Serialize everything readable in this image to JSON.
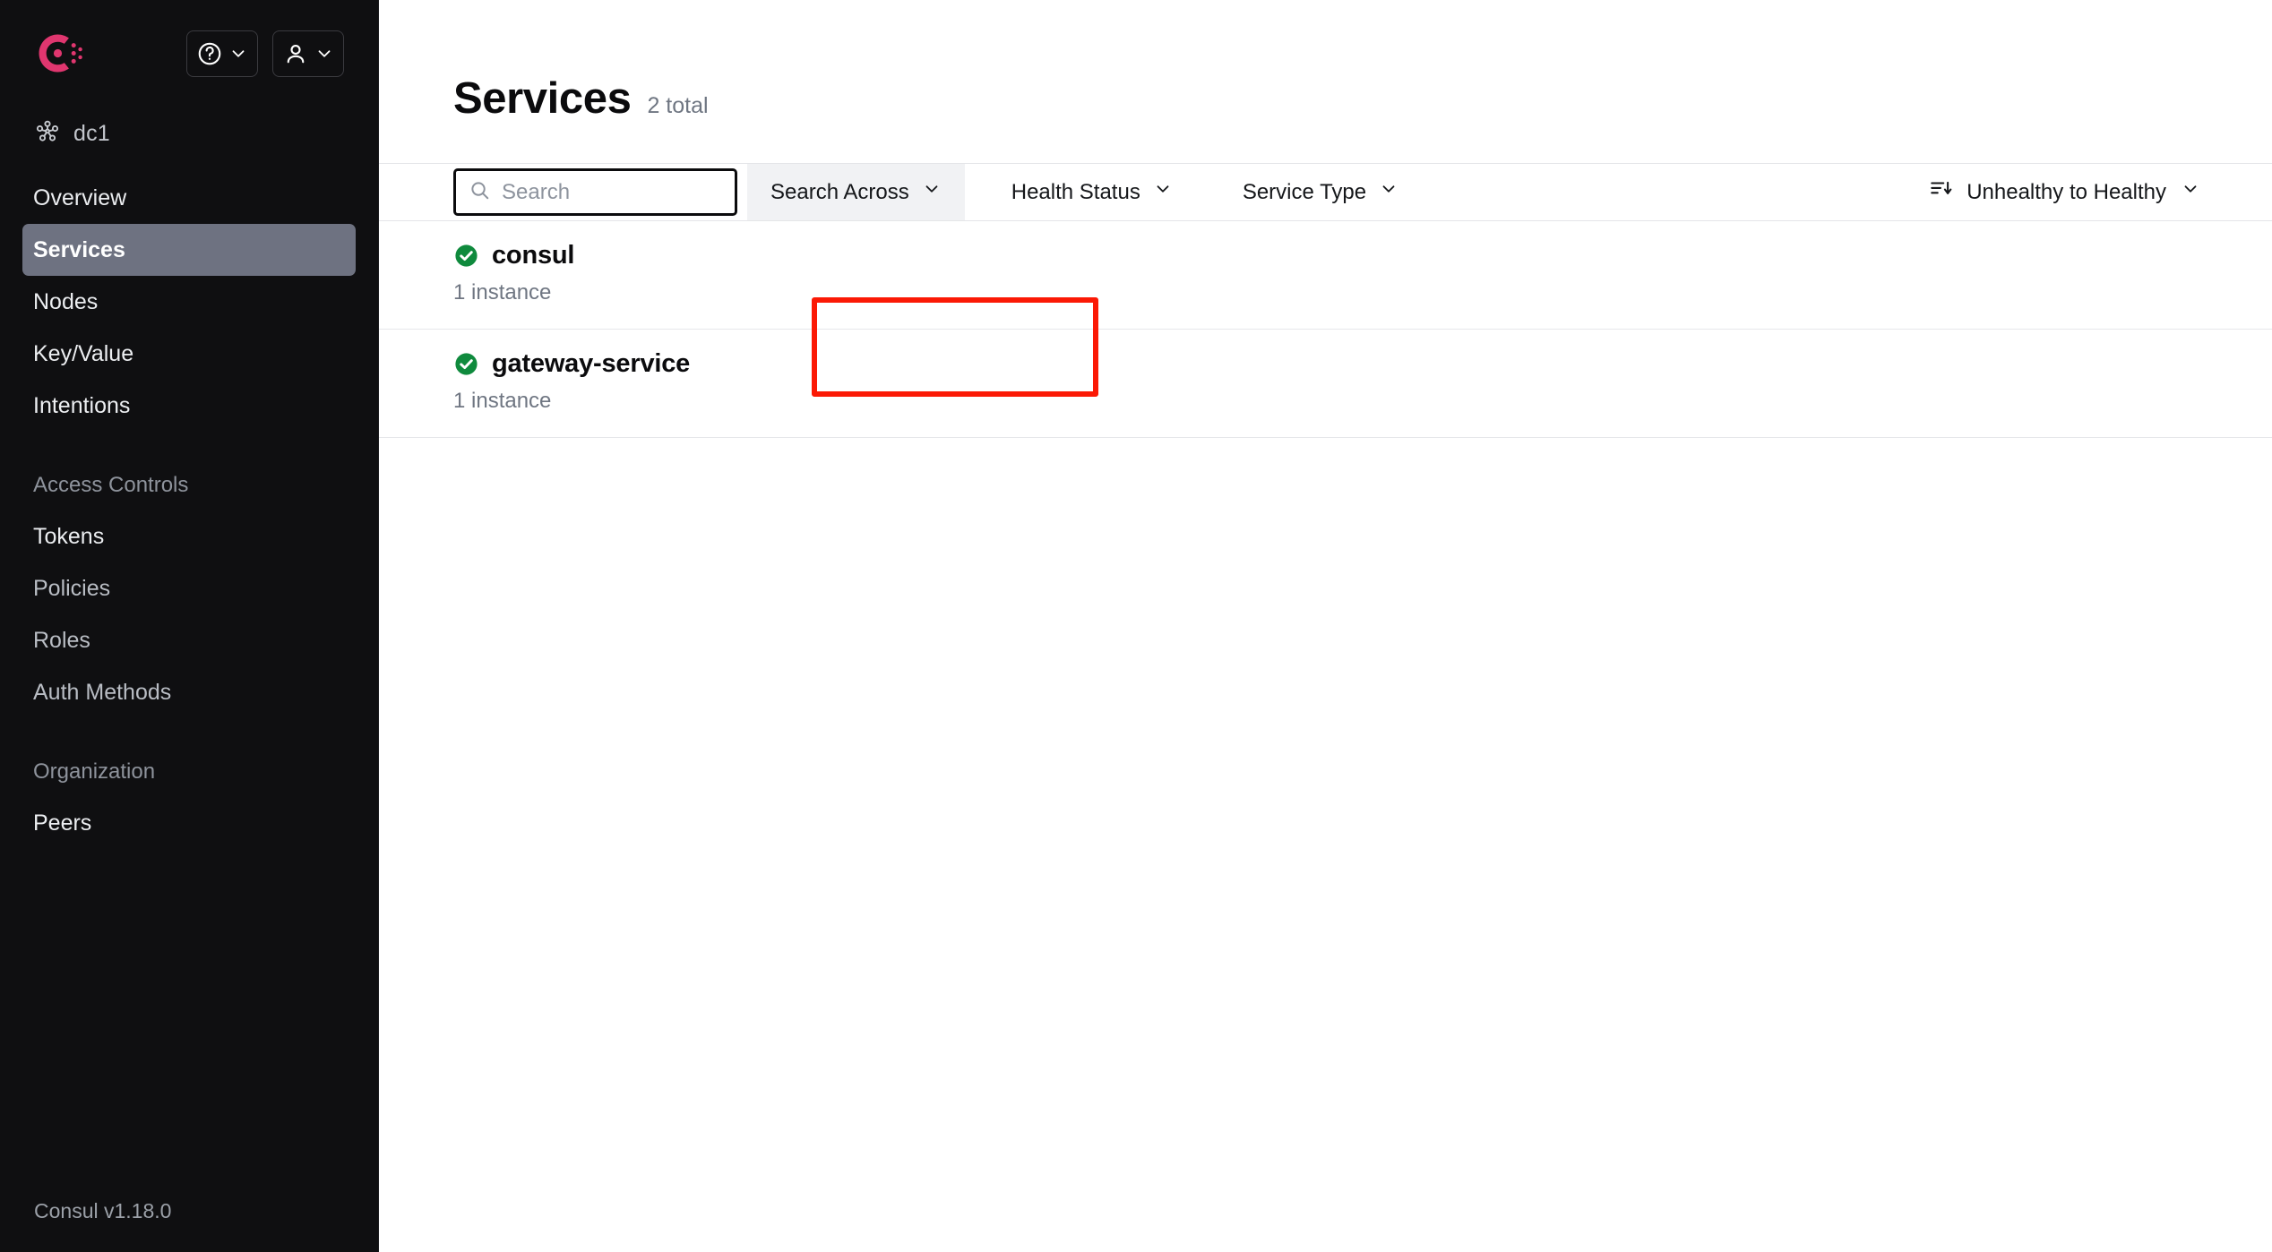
{
  "app": {
    "name": "Consul",
    "version_label": "Consul v1.18.0",
    "brand_color": "#e0366f"
  },
  "sidebar": {
    "logo_name": "consul-logo",
    "help_button": {
      "icon": "help-circle-icon",
      "chevron": "chevron-down-icon"
    },
    "user_button": {
      "icon": "user-icon",
      "chevron": "chevron-down-icon"
    },
    "datacenter": {
      "icon": "nodes-icon",
      "label": "dc1"
    },
    "nav": [
      {
        "label": "Overview",
        "active": false,
        "dim": false
      },
      {
        "label": "Services",
        "active": true,
        "dim": false
      },
      {
        "label": "Nodes",
        "active": false,
        "dim": false
      },
      {
        "label": "Key/Value",
        "active": false,
        "dim": false
      },
      {
        "label": "Intentions",
        "active": false,
        "dim": false
      }
    ],
    "sections": [
      {
        "title": "Access Controls",
        "items": [
          {
            "label": "Tokens",
            "active": false,
            "dim": false
          },
          {
            "label": "Policies",
            "active": false,
            "dim": true
          },
          {
            "label": "Roles",
            "active": false,
            "dim": true
          },
          {
            "label": "Auth Methods",
            "active": false,
            "dim": true
          }
        ]
      },
      {
        "title": "Organization",
        "items": [
          {
            "label": "Peers",
            "active": false,
            "dim": false
          }
        ]
      }
    ]
  },
  "main": {
    "title": "Services",
    "count_label": "2 total",
    "toolbar": {
      "search_placeholder": "Search",
      "search_value": "",
      "search_icon": "search-icon",
      "search_across_label": "Search Across",
      "health_status_label": "Health Status",
      "service_type_label": "Service Type",
      "sort_label": "Unhealthy to Healthy",
      "sort_icon": "sort-descending-icon"
    },
    "services": [
      {
        "name": "consul",
        "instances_label": "1 instance",
        "status": "healthy",
        "status_icon": "check-circle-icon",
        "status_color": "#0f8a3d",
        "highlighted": false
      },
      {
        "name": "gateway-service",
        "instances_label": "1 instance",
        "status": "healthy",
        "status_icon": "check-circle-icon",
        "status_color": "#0f8a3d",
        "highlighted": true
      }
    ]
  },
  "annotation": {
    "color": "#fb1905",
    "target": "gateway-service"
  }
}
